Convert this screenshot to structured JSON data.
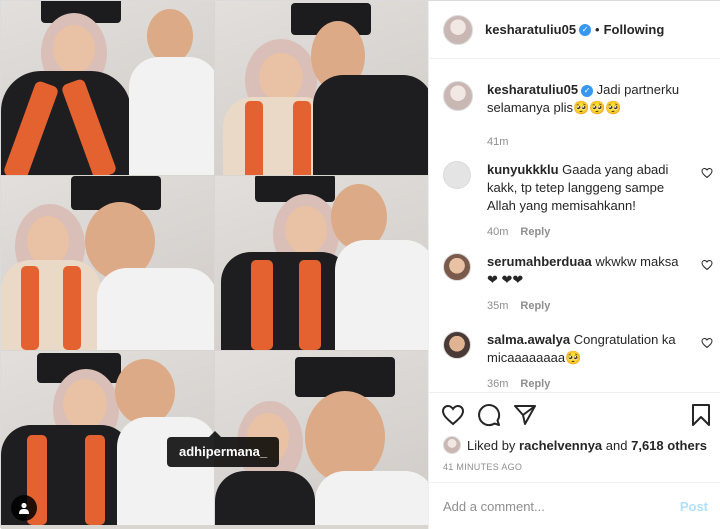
{
  "photo": {
    "tag_label": "adhipermana_"
  },
  "header": {
    "username": "kesharatuliu05",
    "separator": "•",
    "follow_status": "Following"
  },
  "caption": {
    "username": "kesharatuliu05",
    "text": "Jadi partnerku selamanya plis🥺🥺🥺",
    "time": "41m"
  },
  "comments": [
    {
      "username": "kunyukkklu",
      "text": "Gaada yang abadi kakk, tp tetep langgeng sampe Allah yang memisahkann!",
      "time": "40m",
      "reply": "Reply"
    },
    {
      "username": "serumahberduaa",
      "text": "wkwkw maksa❤ ❤❤",
      "time": "35m",
      "reply": "Reply"
    },
    {
      "username": "salma.awalya",
      "text": "Congratulation ka micaaaaaaaa🥺",
      "time": "36m",
      "reply": "Reply"
    }
  ],
  "likes": {
    "prefix": "Liked by",
    "user": "rachelvennya",
    "connector": "and",
    "others": "7,618 others"
  },
  "timestamp": "41 MINUTES AGO",
  "add_comment": {
    "placeholder": "Add a comment...",
    "post_label": "Post"
  },
  "icons": {
    "like": "heart-icon",
    "comment": "comment-icon",
    "share": "share-icon",
    "save": "bookmark-icon",
    "verified": "verified-badge-icon",
    "user_tags": "person-icon"
  },
  "colors": {
    "verified": "#3897f0",
    "post_disabled": "#b2dffc",
    "secondary_text": "#8e8e8e",
    "border": "#dbdbdb"
  }
}
